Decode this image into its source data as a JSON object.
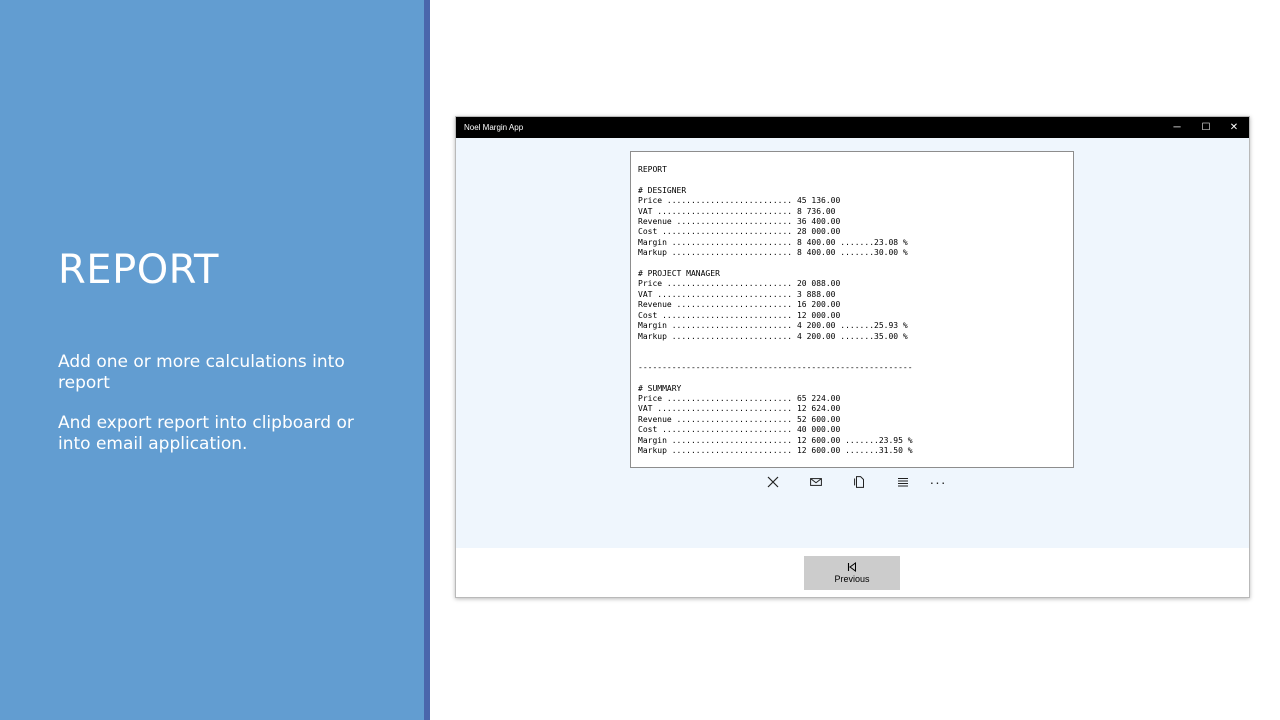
{
  "slide": {
    "title": "REPORT",
    "paragraphs": [
      "Add one or more calculations into report",
      "And export report into clipboard or into email application."
    ]
  },
  "app": {
    "window_title": "Noel Margin App",
    "controls": {
      "minimize": "─",
      "maximize": "☐",
      "close": "✕"
    },
    "report_text": "REPORT\n\n# DESIGNER\nPrice .......................... 45 136.00\nVAT ............................ 8 736.00\nRevenue ........................ 36 400.00\nCost ........................... 28 000.00\nMargin ......................... 8 400.00 .......23.08 %\nMarkup ......................... 8 400.00 .......30.00 %\n\n# PROJECT MANAGER\nPrice .......................... 20 088.00\nVAT ............................ 3 888.00\nRevenue ........................ 16 200.00\nCost ........................... 12 000.00\nMargin ......................... 4 200.00 .......25.93 %\nMarkup ......................... 4 200.00 .......35.00 %\n\n\n---------------------------------------------------------\n\n# SUMMARY\nPrice .......................... 65 224.00\nVAT ............................ 12 624.00\nRevenue ........................ 52 600.00\nCost ........................... 40 000.00\nMargin ......................... 12 600.00 .......23.95 %\nMarkup ......................... 12 600.00 .......31.50 %",
    "toolbar": {
      "icons": [
        "cancel-icon",
        "mail-icon",
        "copy-icon",
        "list-icon",
        "more-icon"
      ],
      "more_label": "···"
    },
    "footer": {
      "previous_label": "Previous"
    }
  },
  "colors": {
    "panel": "#629dd1",
    "stripe": "#4a66ac",
    "content_bg": "#eff6fd",
    "titlebar": "#000000",
    "button_bg": "#cccccc"
  }
}
